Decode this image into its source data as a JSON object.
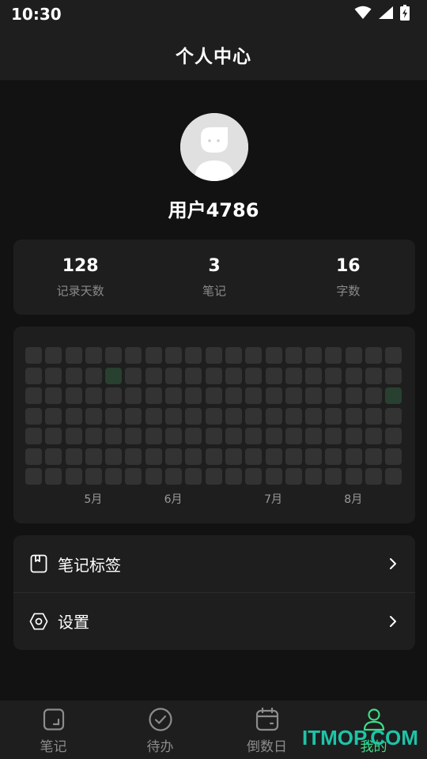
{
  "status_bar": {
    "time": "10:30"
  },
  "header": {
    "title": "个人中心"
  },
  "profile": {
    "username": "用户4786"
  },
  "stats": [
    {
      "value": "128",
      "label": "记录天数"
    },
    {
      "value": "3",
      "label": "笔记"
    },
    {
      "value": "16",
      "label": "字数"
    }
  ],
  "heatmap": {
    "rows": 7,
    "columns": 19,
    "active_cells": [
      [
        1,
        4
      ],
      [
        2,
        18
      ]
    ],
    "months": [
      {
        "label": "5月",
        "column": 3
      },
      {
        "label": "6月",
        "column": 7
      },
      {
        "label": "7月",
        "column": 12
      },
      {
        "label": "8月",
        "column": 16
      }
    ]
  },
  "menu": {
    "tags_label": "笔记标签",
    "settings_label": "设置"
  },
  "nav": {
    "items": [
      {
        "label": "笔记",
        "icon": "note-icon"
      },
      {
        "label": "待办",
        "icon": "check-circle-icon"
      },
      {
        "label": "倒数日",
        "icon": "calendar-icon"
      },
      {
        "label": "我的",
        "icon": "person-icon"
      }
    ],
    "active_index": 3
  },
  "colors": {
    "accent": "#3ddc84",
    "background": "#121212",
    "card": "#1e1e1e",
    "cell": "#333333",
    "cell_active": "#28402f"
  },
  "watermark": "ITMOP.COM"
}
